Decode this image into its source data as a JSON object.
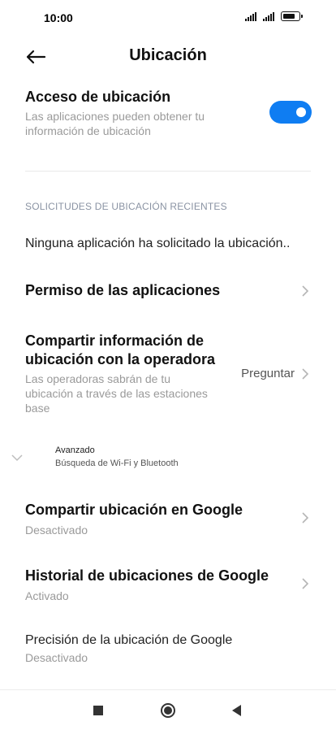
{
  "status_bar": {
    "time": "10:00",
    "battery_level": 0.9
  },
  "header": {
    "title": "Ubicación"
  },
  "location_access": {
    "title": "Acceso de ubicación",
    "subtitle_line1": "Las aplicaciones pueden obtener tu",
    "subtitle_line2": "información de ubicación",
    "enabled": true
  },
  "recent_requests": {
    "header": "SOLICITUDES DE UBICACIÓN RECIENTES",
    "empty_text": "Ninguna aplicación ha solicitado la ubicación.."
  },
  "items": {
    "app_permissions": {
      "title": "Permiso de las aplicaciones"
    },
    "carrier_sharing": {
      "title_line1": "Compartir información de",
      "title_line2": "ubicación con la operadora",
      "subtitle_line1": "Las operadoras sabrán de tu",
      "subtitle_line2": "ubicación a través de las estaciones",
      "subtitle_line3": "base",
      "value": "Preguntar"
    },
    "advanced": {
      "title": "Avanzado",
      "subtitle": "Búsqueda de Wi-Fi y Bluetooth"
    },
    "google_share": {
      "title": "Compartir ubicación en Google",
      "subtitle": "Desactivado"
    },
    "google_history": {
      "title": "Historial de ubicaciones de Google",
      "subtitle": "Activado"
    },
    "google_accuracy": {
      "title": "Precisión de la ubicación de Google",
      "subtitle": "Desactivado"
    }
  },
  "colors": {
    "accent": "#0f7df2",
    "subtext": "#9a9a9a",
    "section": "#8a93a3"
  }
}
